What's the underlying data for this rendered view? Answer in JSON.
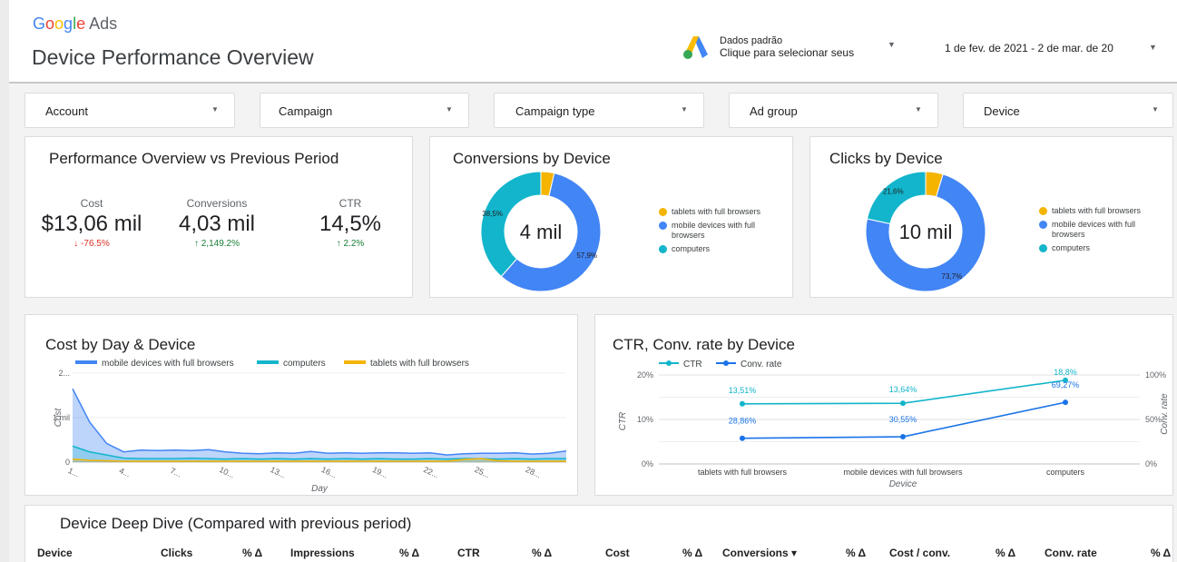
{
  "header": {
    "brand": {
      "g1": "G",
      "g2": "o",
      "g3": "o",
      "g4": "g",
      "g5": "l",
      "g6": "e",
      "suffix": " Ads"
    },
    "title": "Device Performance Overview",
    "data_source": {
      "line1": "Dados padrão",
      "line2": "Clique para selecionar seus"
    },
    "date_range": "1 de fev. de 2021 - 2 de mar. de 20"
  },
  "filters": [
    "Account",
    "Campaign",
    "Campaign type",
    "Ad group",
    "Device"
  ],
  "performance": {
    "title": "Performance Overview vs Previous Period",
    "kpis": [
      {
        "label": "Cost",
        "value": "$13,06 mil",
        "change": "-76.5%",
        "direction": "down"
      },
      {
        "label": "Conversions",
        "value": "4,03 mil",
        "change": "2,149.2%",
        "direction": "up"
      },
      {
        "label": "CTR",
        "value": "14,5%",
        "change": "2.2%",
        "direction": "up"
      }
    ]
  },
  "colors": {
    "tablets": "#f4b400",
    "mobile": "#4285f4",
    "computers": "#12b5cb",
    "ctr": "#12b5cb",
    "conv": "#1a73e8"
  },
  "conversions_card": {
    "title": "Conversions by Device",
    "center": "4 mil",
    "legend": [
      "tablets with full browsers",
      "mobile devices with full browsers",
      "computers"
    ]
  },
  "clicks_card": {
    "title": "Clicks by Device",
    "center": "10 mil",
    "legend": [
      "tablets with full browsers",
      "mobile devices with full browsers",
      "computers"
    ]
  },
  "cost_card": {
    "title": "Cost by Day & Device"
  },
  "ctr_card": {
    "title": "CTR, Conv. rate by Device"
  },
  "table": {
    "title": "Device Deep Dive (Compared with previous period)",
    "headers": [
      "Device",
      "Clicks",
      "% Δ",
      "Impressions",
      "% Δ",
      "CTR",
      "% Δ",
      "Cost",
      "% Δ",
      "Conversions ▾",
      "% Δ",
      "Cost / conv.",
      "% Δ",
      "Conv. rate",
      "% Δ"
    ]
  },
  "chart_data": [
    {
      "type": "pie",
      "title": "Conversions by Device",
      "categories": [
        "tablets with full browsers",
        "mobile devices with full browsers",
        "computers"
      ],
      "values": [
        3.6,
        57.9,
        38.5
      ],
      "labels": [
        "",
        "57,9%",
        "38,5%"
      ]
    },
    {
      "type": "pie",
      "title": "Clicks by Device",
      "categories": [
        "tablets with full browsers",
        "mobile devices with full browsers",
        "computers"
      ],
      "values": [
        4.7,
        73.7,
        21.6
      ],
      "labels": [
        "",
        "73,7%",
        "21,6%"
      ]
    },
    {
      "type": "area",
      "title": "Cost by Day & Device",
      "xlabel": "Day",
      "ylabel": "Cost",
      "ylim": [
        0,
        2000
      ],
      "y_ticks": [
        "0",
        "1 mil",
        "2..."
      ],
      "x_ticks": [
        "1...",
        "4...",
        "7...",
        "10...",
        "13...",
        "16...",
        "19...",
        "22...",
        "25...",
        "28..."
      ],
      "x": [
        1,
        2,
        3,
        4,
        5,
        6,
        7,
        8,
        9,
        10,
        11,
        12,
        13,
        14,
        15,
        16,
        17,
        18,
        19,
        20,
        21,
        22,
        23,
        24,
        25,
        26,
        27,
        28,
        29,
        30
      ],
      "series": [
        {
          "name": "mobile devices with full browsers",
          "values": [
            1650,
            900,
            420,
            230,
            270,
            260,
            270,
            260,
            280,
            230,
            200,
            190,
            210,
            200,
            240,
            200,
            210,
            200,
            210,
            210,
            200,
            210,
            160,
            190,
            200,
            200,
            210,
            180,
            200,
            250
          ]
        },
        {
          "name": "computers",
          "values": [
            360,
            230,
            160,
            90,
            80,
            80,
            80,
            90,
            80,
            70,
            80,
            70,
            80,
            70,
            80,
            70,
            80,
            70,
            80,
            70,
            70,
            80,
            70,
            80,
            80,
            70,
            80,
            70,
            80,
            80
          ]
        },
        {
          "name": "tablets with full browsers",
          "values": [
            70,
            40,
            30,
            20,
            20,
            20,
            20,
            20,
            20,
            20,
            20,
            20,
            20,
            20,
            20,
            20,
            20,
            20,
            20,
            20,
            20,
            20,
            20,
            60,
            80,
            30,
            20,
            20,
            20,
            20
          ]
        }
      ]
    },
    {
      "type": "line",
      "title": "CTR, Conv. rate by Device",
      "xlabel": "Device",
      "ylabel": "CTR",
      "y2label": "Conv. rate",
      "ylim": [
        0,
        20
      ],
      "y2lim": [
        0,
        100
      ],
      "y_ticks": [
        "0%",
        "10%",
        "20%"
      ],
      "y2_ticks": [
        "0%",
        "50%",
        "100%"
      ],
      "categories": [
        "tablets with full browsers",
        "mobile devices with full browsers",
        "computers"
      ],
      "series": [
        {
          "name": "CTR",
          "axis": "left",
          "values": [
            13.51,
            13.64,
            18.8
          ],
          "labels": [
            "13,51%",
            "13,64%",
            "18,8%"
          ]
        },
        {
          "name": "Conv. rate",
          "axis": "right",
          "values": [
            28.86,
            30.55,
            69.27
          ],
          "labels": [
            "28,86%",
            "30,55%",
            "69,27%"
          ]
        }
      ]
    }
  ]
}
